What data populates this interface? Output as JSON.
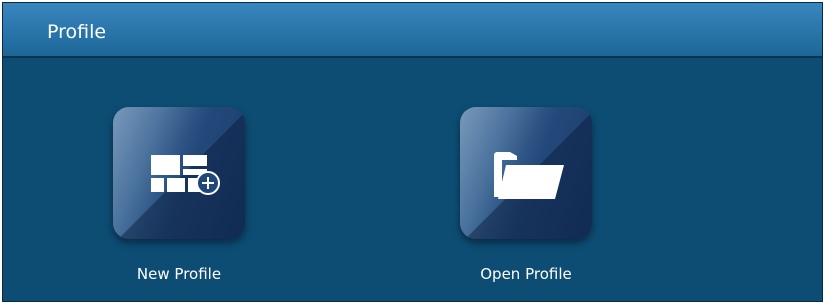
{
  "window": {
    "title": "Profile"
  },
  "actions": [
    {
      "label": "New Profile",
      "icon": "new-profile-icon"
    },
    {
      "label": "Open Profile",
      "icon": "folder-open-icon"
    }
  ],
  "colors": {
    "panel_bg": "#0d4d74",
    "header_top": "#3a87bd",
    "header_bottom": "#1d6797",
    "tile_light": "#5a82ab",
    "tile_dark": "#183a6a",
    "text": "#ffffff"
  }
}
